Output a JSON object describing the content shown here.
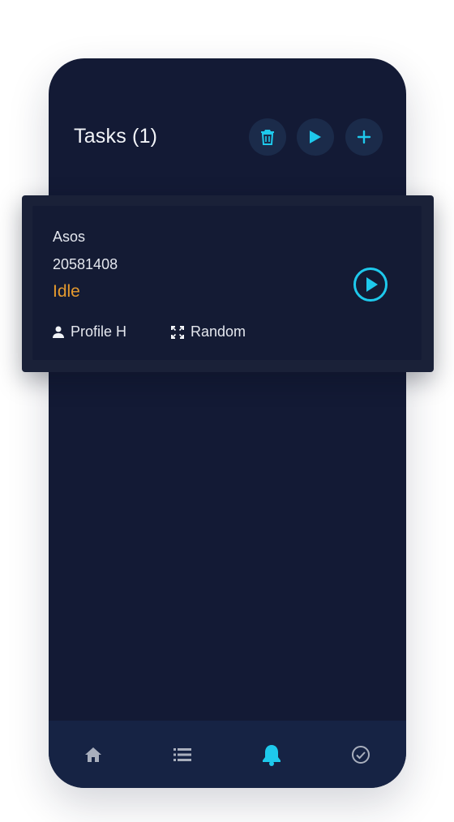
{
  "header": {
    "title": "Tasks (1)",
    "actions": [
      {
        "name": "delete",
        "icon": "trash-icon"
      },
      {
        "name": "run-all",
        "icon": "play-icon"
      },
      {
        "name": "add",
        "icon": "plus-icon"
      }
    ]
  },
  "task": {
    "site": "Asos",
    "sku": "20581408",
    "status": "Idle",
    "profile": "Profile H",
    "proxy": "Random",
    "status_color": "#e59a2e"
  },
  "nav": {
    "items": [
      {
        "icon": "home-icon",
        "active": false
      },
      {
        "icon": "list-icon",
        "active": false
      },
      {
        "icon": "bell-icon",
        "active": true
      },
      {
        "icon": "check-circle-icon",
        "active": false
      }
    ]
  },
  "colors": {
    "accent": "#1ec9ec",
    "background": "#131a35",
    "nav_background": "#162344",
    "card_background": "#141b34"
  }
}
